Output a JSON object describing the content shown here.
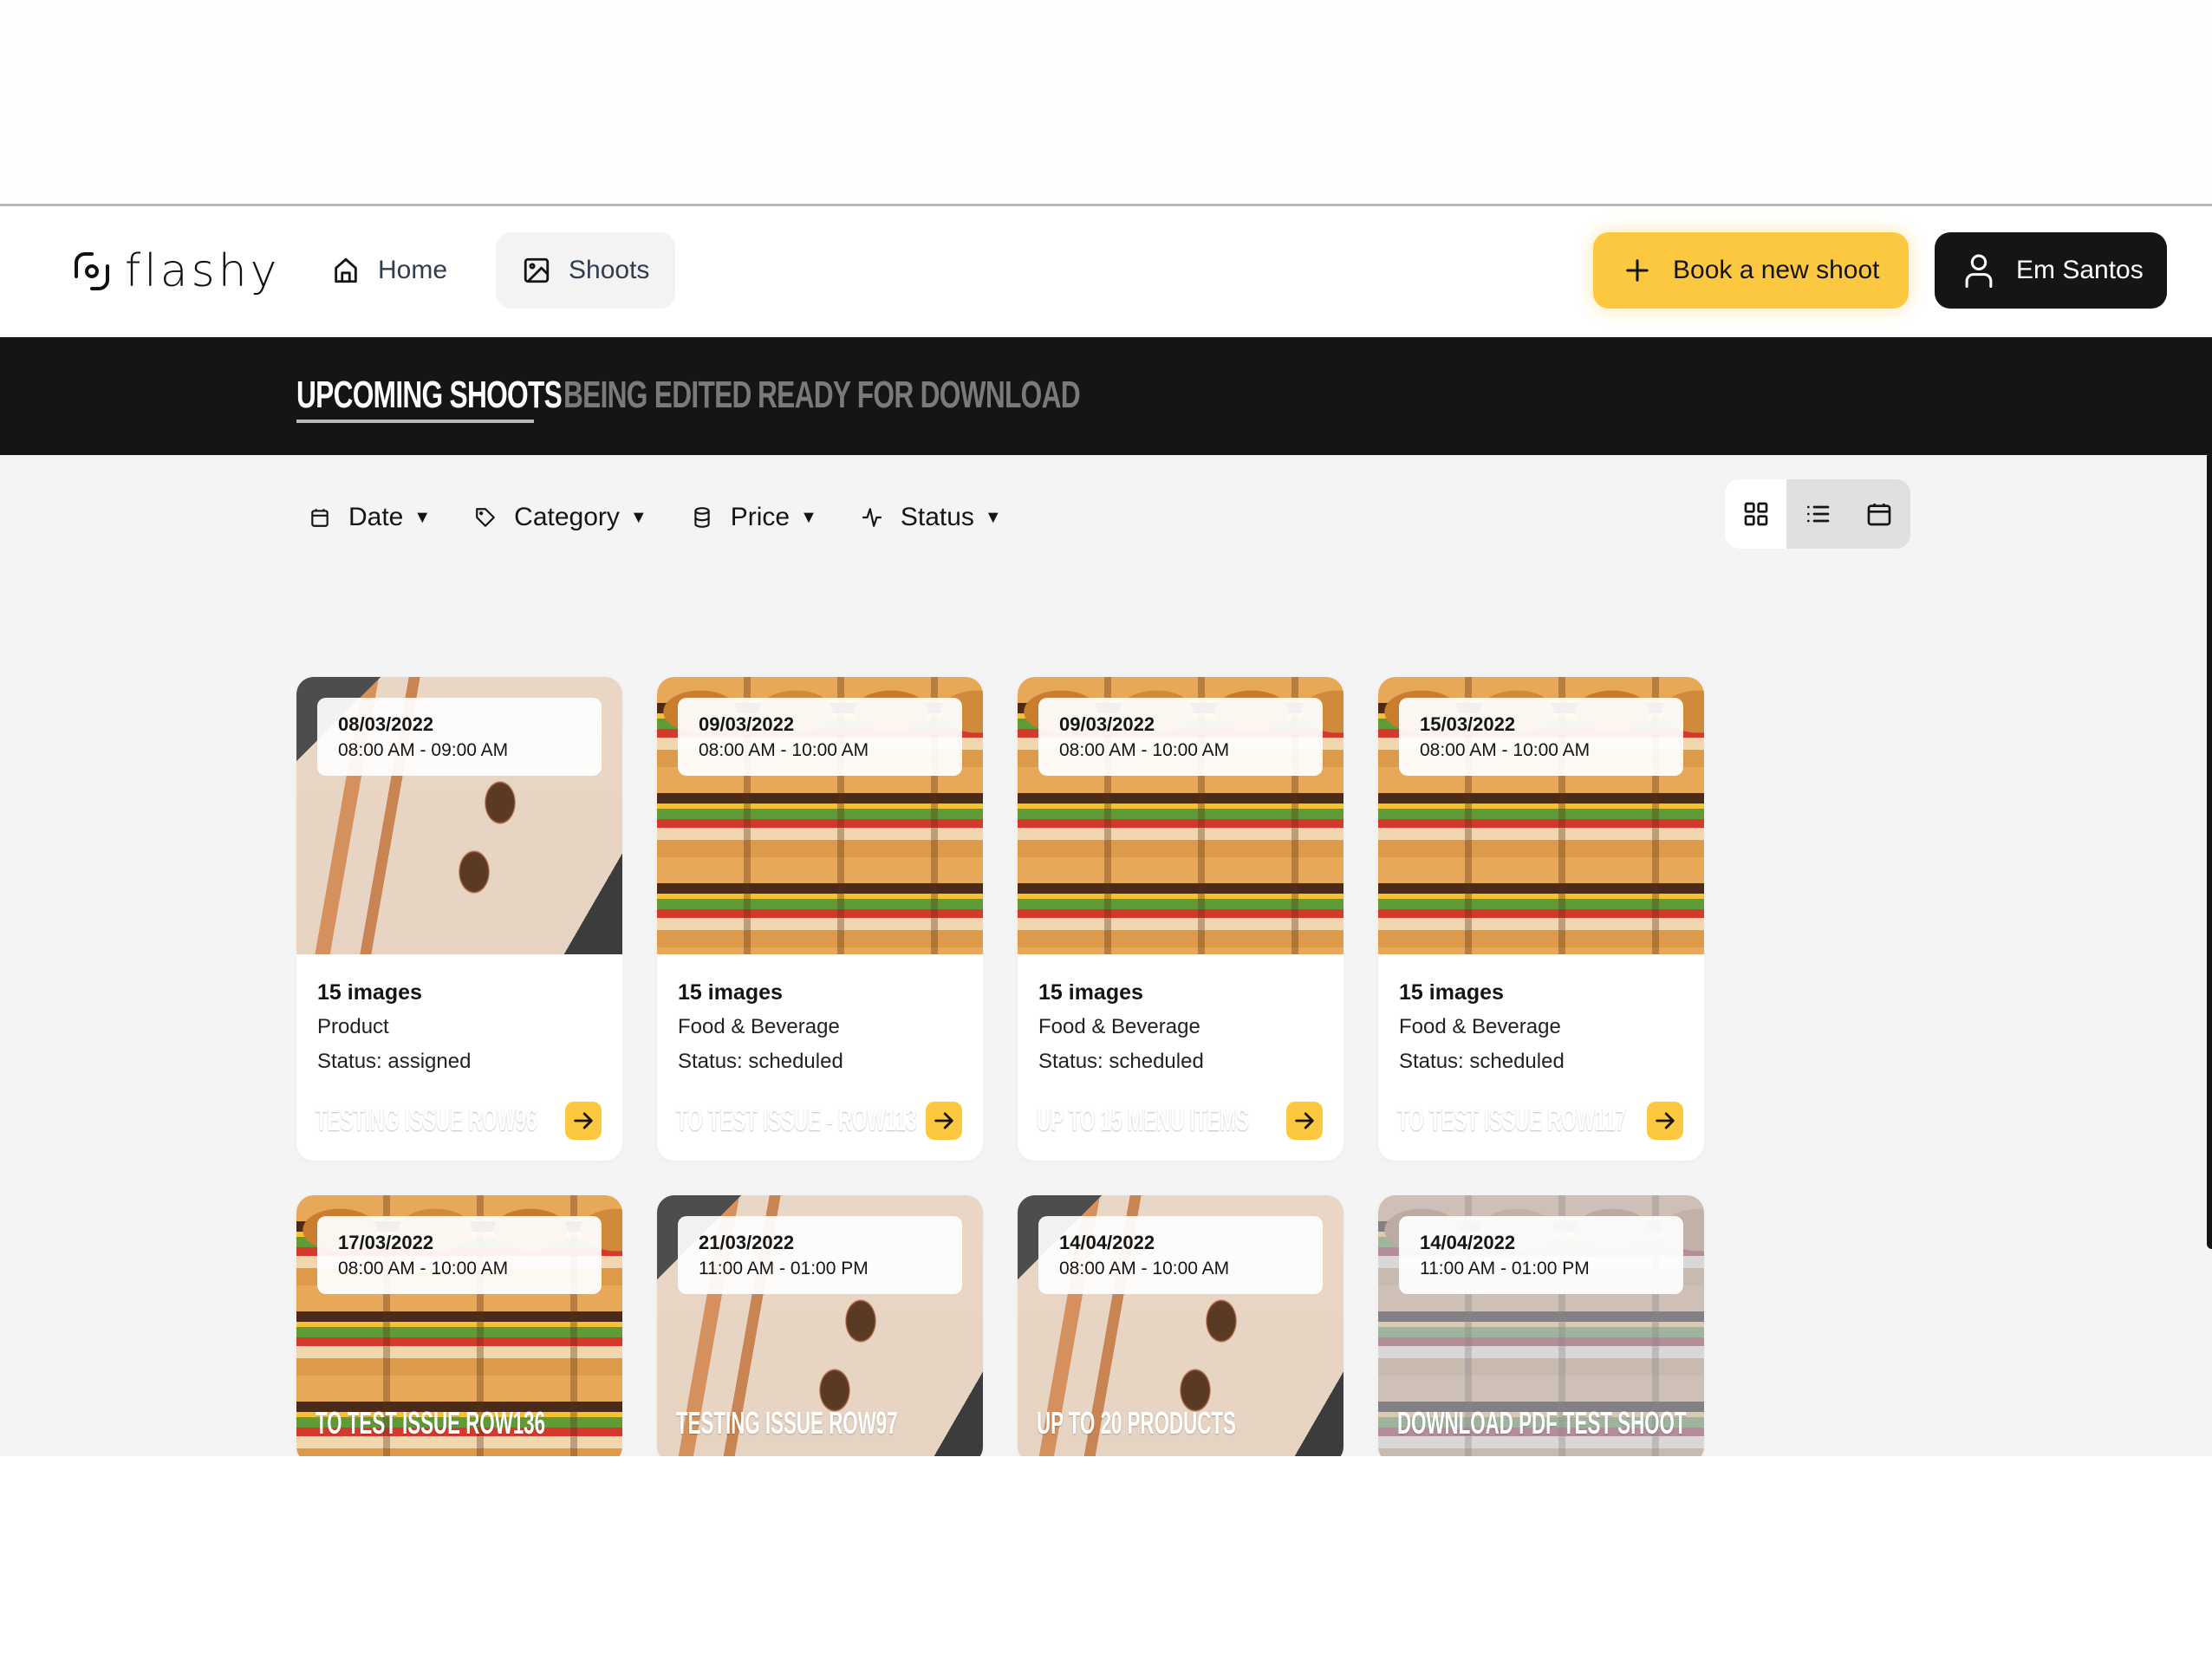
{
  "brand": {
    "name": "flashy",
    "accent": "#fbc840",
    "dark": "#151515"
  },
  "nav": {
    "items": [
      {
        "label": "Home",
        "icon": "home-icon",
        "active": false
      },
      {
        "label": "Shoots",
        "icon": "image-icon",
        "active": true
      }
    ],
    "book_button": {
      "label": "Book a new shoot",
      "icon": "plus-icon"
    },
    "user_button": {
      "label": "Em Santos",
      "icon": "user-icon"
    }
  },
  "tabs": [
    {
      "label": "UPCOMING SHOOTS",
      "active": true
    },
    {
      "label": "BEING EDITED",
      "active": false
    },
    {
      "label": "READY FOR DOWNLOAD",
      "active": false
    }
  ],
  "filters": [
    {
      "label": "Date",
      "icon": "calendar-icon"
    },
    {
      "label": "Category",
      "icon": "tag-icon"
    },
    {
      "label": "Price",
      "icon": "database-icon"
    },
    {
      "label": "Status",
      "icon": "activity-icon"
    }
  ],
  "view_modes": [
    {
      "name": "grid",
      "icon": "grid-icon",
      "active": true
    },
    {
      "name": "list",
      "icon": "list-icon",
      "active": false
    },
    {
      "name": "calendar",
      "icon": "calendar-icon",
      "active": false
    }
  ],
  "shoots": [
    {
      "date": "08/03/2022",
      "time": "08:00 AM - 09:00 AM",
      "title": "TESTING ISSUE ROW96",
      "images": "15 images",
      "category": "Product",
      "status": "Status: assigned",
      "image": "product"
    },
    {
      "date": "09/03/2022",
      "time": "08:00 AM - 10:00 AM",
      "title": "TO TEST ISSUE - ROW113",
      "images": "15 images",
      "category": "Food & Beverage",
      "status": "Status: scheduled",
      "image": "burger"
    },
    {
      "date": "09/03/2022",
      "time": "08:00 AM - 10:00 AM",
      "title": "UP TO 15 MENU ITEMS",
      "images": "15 images",
      "category": "Food & Beverage",
      "status": "Status: scheduled",
      "image": "burger"
    },
    {
      "date": "15/03/2022",
      "time": "08:00 AM - 10:00 AM",
      "title": "TO TEST ISSUE ROW117",
      "images": "15 images",
      "category": "Food & Beverage",
      "status": "Status: scheduled",
      "image": "burger"
    },
    {
      "date": "17/03/2022",
      "time": "08:00 AM - 10:00 AM",
      "title": "TO TEST ISSUE ROW136",
      "image": "burger"
    },
    {
      "date": "21/03/2022",
      "time": "11:00 AM - 01:00 PM",
      "title": "TESTING ISSUE ROW97",
      "image": "product"
    },
    {
      "date": "14/04/2022",
      "time": "08:00 AM - 10:00 AM",
      "title": "UP TO 20 PRODUCTS",
      "image": "product"
    },
    {
      "date": "14/04/2022",
      "time": "11:00 AM - 01:00 PM",
      "title": "DOWNLOAD PDF TEST SHOOT",
      "image": "burger-faded"
    }
  ]
}
